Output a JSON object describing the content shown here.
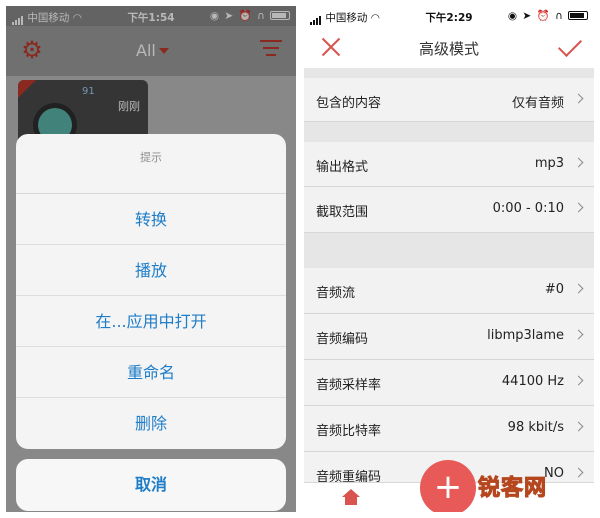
{
  "left_phone": {
    "status": {
      "carrier": "中国移动",
      "time": "下午1:54"
    },
    "toolbar": {
      "filter_label": "All"
    },
    "item": {
      "timestamp": "刚刚",
      "meter_value": "91"
    },
    "action_sheet": {
      "title": "提示",
      "actions": [
        "转换",
        "播放",
        "在...应用中打开",
        "重命名",
        "删除"
      ],
      "cancel": "取消"
    }
  },
  "right_phone": {
    "status": {
      "carrier": "中国移动",
      "time": "下午2:29"
    },
    "nav": {
      "title": "高级模式"
    },
    "rows": [
      {
        "label": "包含的内容",
        "value": "仅有音频"
      },
      {
        "label": "输出格式",
        "value": "mp3"
      },
      {
        "label": "截取范围",
        "value": "0:00 - 0:10"
      },
      {
        "label": "音频流",
        "value": "#0"
      },
      {
        "label": "音频编码",
        "value": "libmp3lame"
      },
      {
        "label": "音频采样率",
        "value": "44100 Hz"
      },
      {
        "label": "音频比特率",
        "value": "98 kbit/s"
      },
      {
        "label": "音频重编码",
        "value": "NO"
      }
    ],
    "fab_label": "+"
  },
  "watermark": "锐客网",
  "colors": {
    "accent": "#d9534f",
    "link_blue": "#1e7dc8",
    "fab": "#e85a58"
  }
}
